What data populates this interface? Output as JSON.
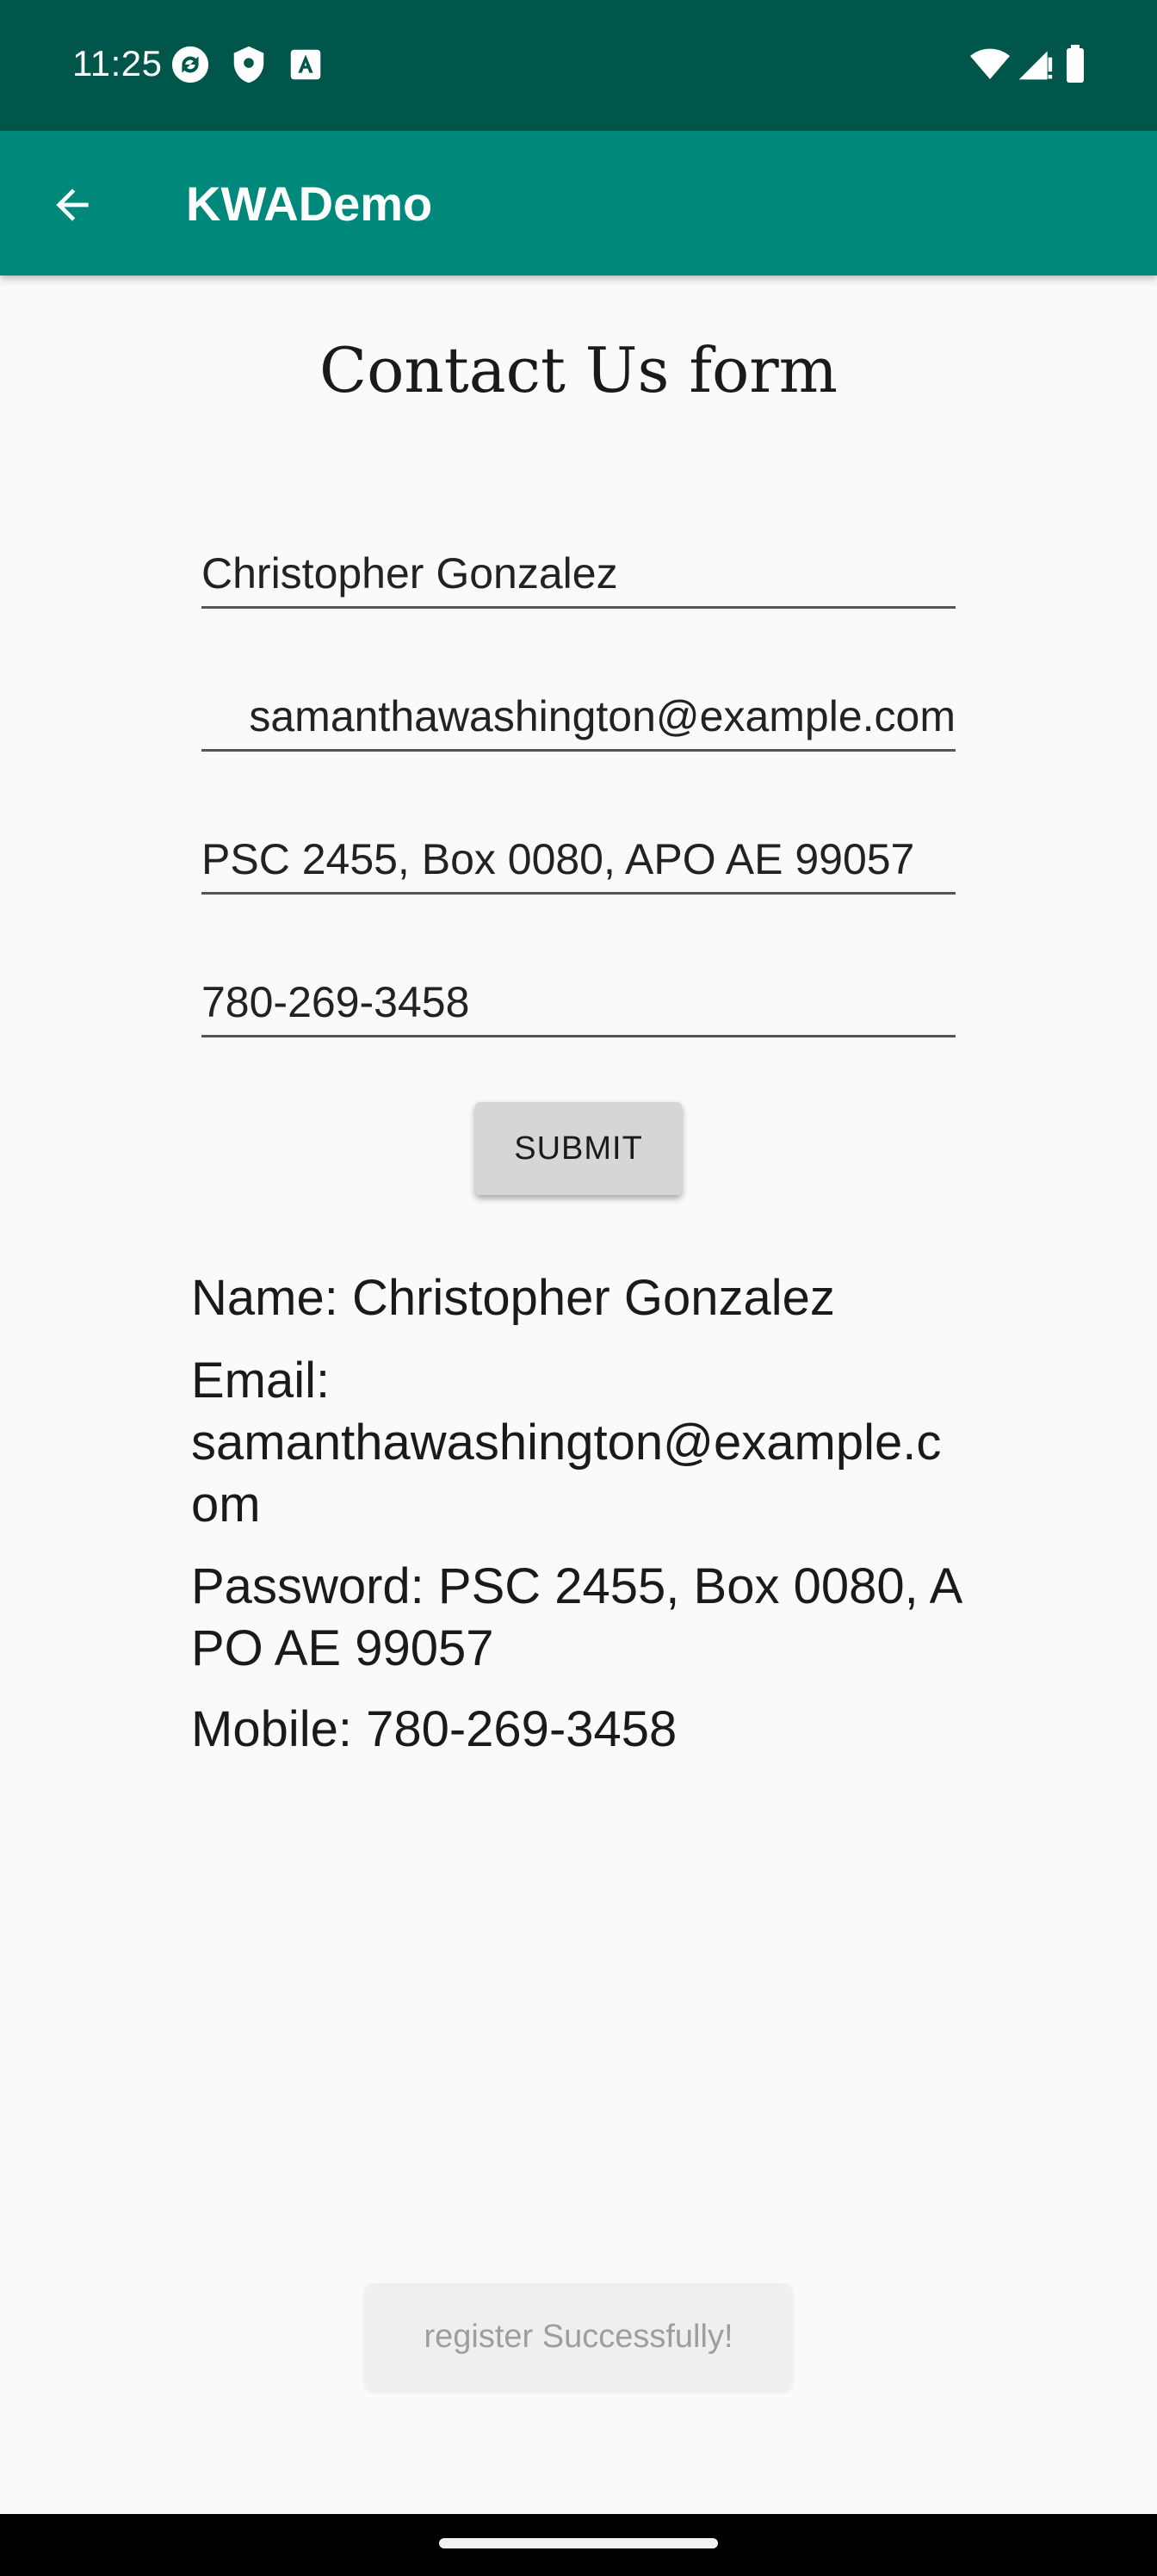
{
  "status_bar": {
    "time": "11:25",
    "icons": [
      "sync-icon",
      "shield-icon",
      "a-keyboard-icon",
      "wifi-icon",
      "signal-icon",
      "battery-icon"
    ],
    "background": "#00564a"
  },
  "app_bar": {
    "title": "KWADemo",
    "background": "#00897b",
    "back_icon": "arrow-back-icon"
  },
  "form": {
    "title": "Contact Us form",
    "name_value": "Christopher Gonzalez",
    "email_value": "samanthawashington@example.com",
    "password_value": "PSC 2455, Box 0080, APO AE 99057",
    "mobile_value": "780-269-3458",
    "submit_label": "SUBMIT"
  },
  "results": {
    "name": "Name: Christopher Gonzalez",
    "email": "Email: samanthawashington@example.com",
    "password": "Password: PSC 2455, Box 0080, APO AE 99057",
    "mobile": "Mobile: 780-269-3458"
  },
  "toast": {
    "message": "register Successfully!"
  }
}
